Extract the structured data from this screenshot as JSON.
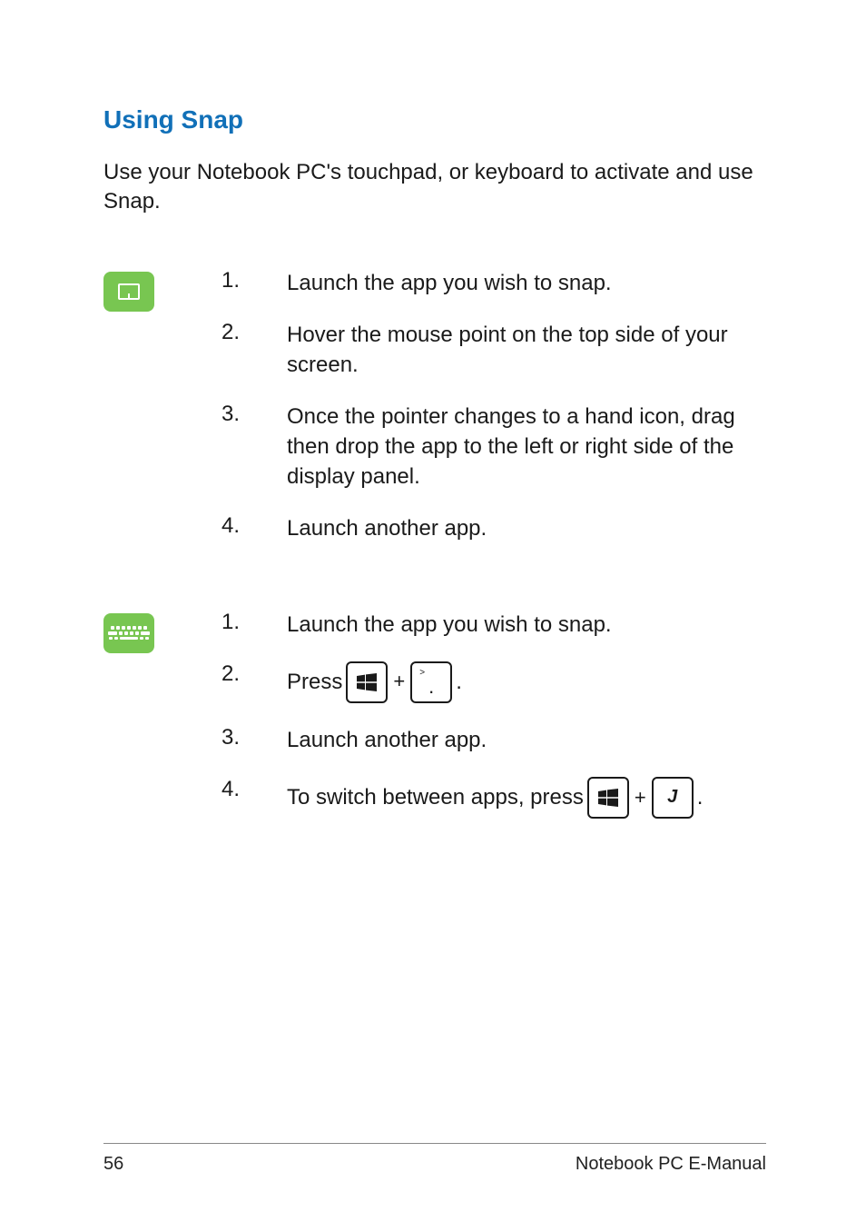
{
  "heading": "Using Snap",
  "intro": "Use your Notebook PC's touchpad, or keyboard to activate and use Snap.",
  "touchpad_steps": [
    {
      "num": "1.",
      "text": "Launch the app you wish to snap."
    },
    {
      "num": "2.",
      "text": "Hover the mouse point on the top side of your screen."
    },
    {
      "num": "3.",
      "text": "Once the pointer changes to a hand icon, drag then drop the app to the left or right side of the display panel."
    },
    {
      "num": "4.",
      "text": "Launch another app."
    }
  ],
  "keyboard_steps": {
    "s1": {
      "num": "1.",
      "text": "Launch the app you wish to snap."
    },
    "s2": {
      "num": "2.",
      "prefix": "Press ",
      "suffix": "."
    },
    "s3": {
      "num": "3.",
      "text": "Launch another app."
    },
    "s4": {
      "num": "4.",
      "prefix": "To switch between apps, press ",
      "suffix": "."
    }
  },
  "keycaps": {
    "plus": "+",
    "period_gt": ">",
    "period_dot": ".",
    "j_label": "J"
  },
  "footer": {
    "page": "56",
    "title": "Notebook PC E-Manual"
  }
}
